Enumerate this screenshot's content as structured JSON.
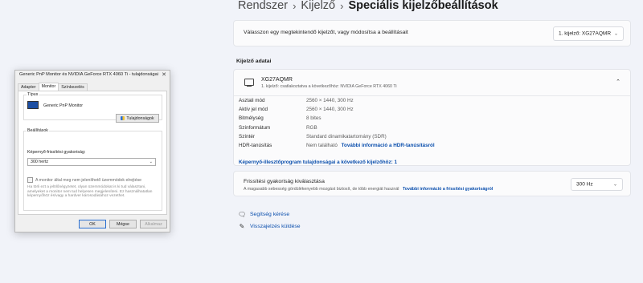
{
  "breadcrumb": {
    "items": [
      "Rendszer",
      "Kijelző"
    ],
    "current": "Speciális kijelzőbeállítások",
    "separator": "›"
  },
  "display_select": {
    "label": "Válasszon egy megtekintendő kijelzőt, vagy módosítsa a beállításait",
    "value": "1. kijelző: XG27AQMR"
  },
  "display_info": {
    "section_title": "Kijelző adatai",
    "name": "XG27AQMR",
    "subtitle": "1. kijelző: csatlakoztatva a következőhöz: NVIDIA GeForce RTX 4060 Ti",
    "properties": [
      {
        "key": "Asztali mód",
        "value": "2560 × 1440, 300 Hz"
      },
      {
        "key": "Aktív jel mód",
        "value": "2560 × 1440, 300 Hz"
      },
      {
        "key": "Bitmélység",
        "value": "8 bites"
      },
      {
        "key": "Színformátum",
        "value": "RGB"
      },
      {
        "key": "Színtér",
        "value": "Standard dinamikatartomány (SDR)"
      }
    ],
    "hdr": {
      "key": "HDR-tanúsítás",
      "value": "Nem található",
      "link": "További információ a HDR-tanúsításról"
    },
    "driver_link": "Képernyő-illesztőprogram tulajdonságai a következő kijelzőhöz: 1"
  },
  "refresh": {
    "title": "Frissítési gyakoriság kiválasztása",
    "desc": "A magasabb sebesség gördülékenyebb mozgást biztosít, de több energiát használ",
    "link": "További információ a frissítési gyakoriságról",
    "value": "300 Hz"
  },
  "help": {
    "get_help": "Segítség kérése",
    "feedback": "Visszajelzés küldése"
  },
  "icons": {
    "monitor": "monitor-icon",
    "chevron": "chevron-down-icon",
    "collapse": "chevron-up-icon",
    "help": "help-icon",
    "feedback": "feedback-icon",
    "close": "close-icon",
    "shield": "shield-icon"
  },
  "dialog": {
    "title": "Generic PnP Monitor és NVIDIA GeForce RTX 4060 Ti - tulajdonságai",
    "close": "✕",
    "tabs": [
      "Adapter",
      "Monitor",
      "Színkezelés"
    ],
    "type_group": "Típus",
    "monitor_name": "Generic PnP Monitor",
    "properties_button": "Tulajdonságok",
    "settings_group": "Beállítások",
    "refresh_label": "Képernyő-frissítési gyakoriság:",
    "refresh_value": "300 hertz",
    "checkbox_label": "A monitor által meg nem jeleníthető üzemmódok elrejtése",
    "description": "Ha törli ezt a jelölőnégyzetet, olyan üzemmódokat is ki tud választani, amelyeket a monitor nem tud helyesen megjeleníteni. Ez használhatatlan képernyőhöz és/vagy a hardver károsodásához vezethet.",
    "ok": "OK",
    "cancel": "Mégse",
    "apply": "Alkalmaz"
  }
}
